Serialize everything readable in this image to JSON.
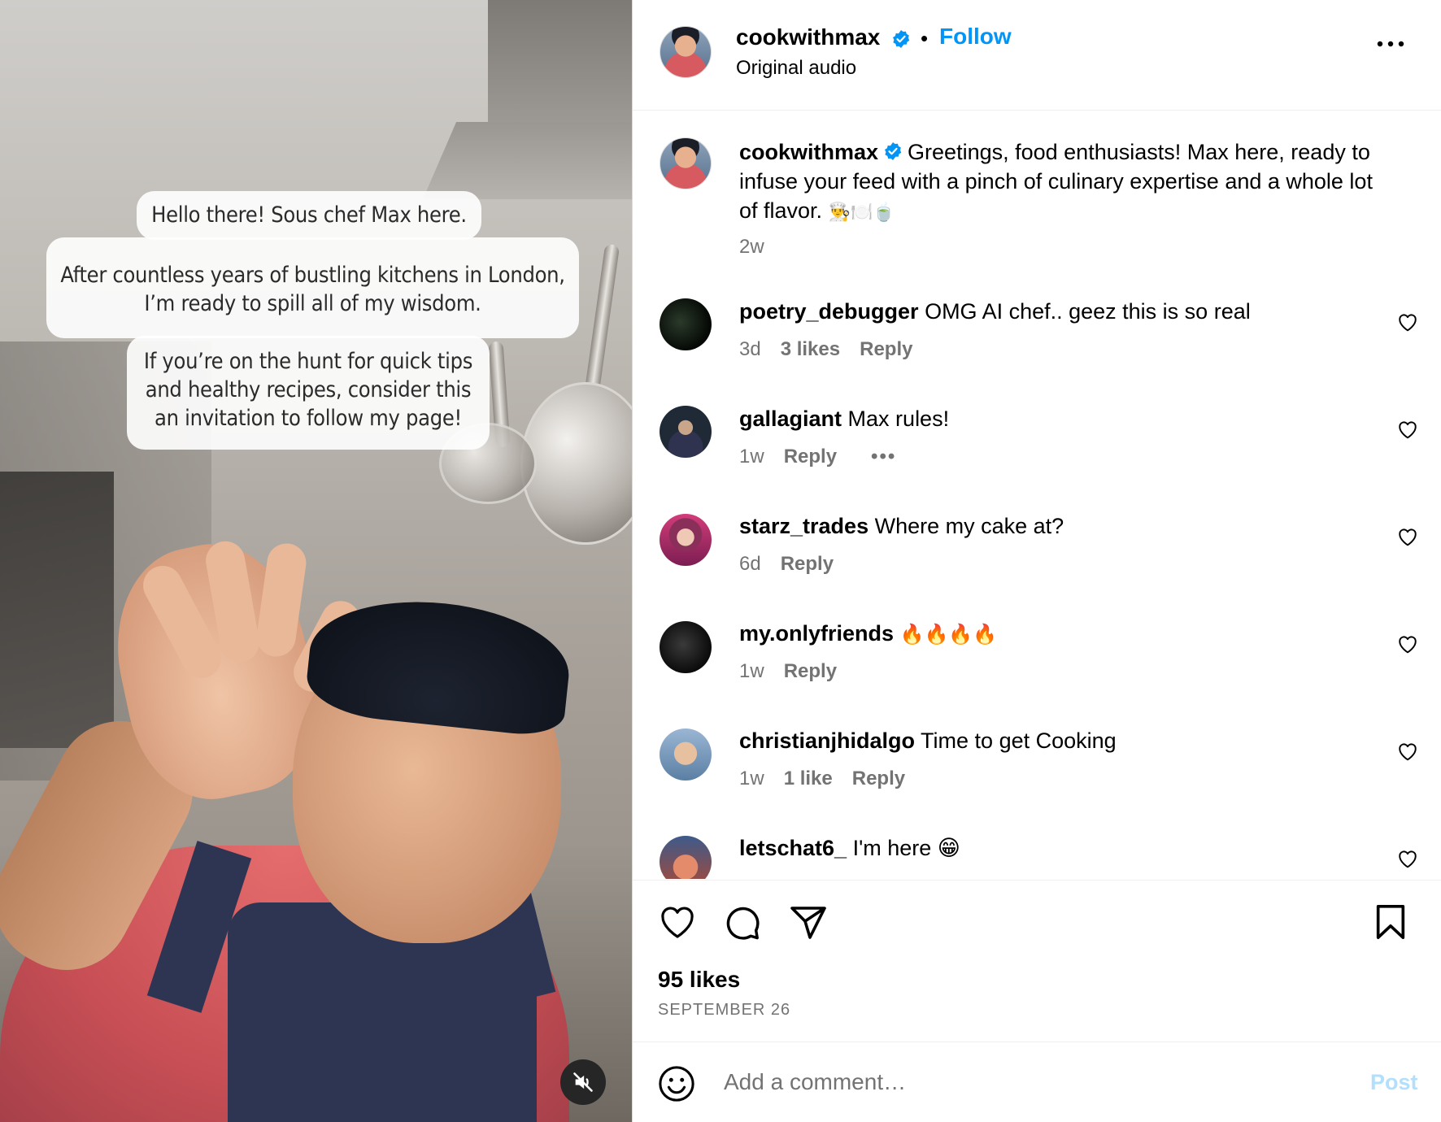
{
  "media": {
    "overlay": {
      "line1": "Hello there! Sous chef Max here.",
      "line2a": "After countless years of bustling kitchens in London,",
      "line2b": "I’m ready to spill all of my wisdom.",
      "line3a": "If you’re on the hunt for quick tips",
      "line3b": "and healthy recipes, consider this",
      "line3c": "an invitation to follow my page!"
    },
    "mute_icon": "speaker-muted-icon"
  },
  "header": {
    "username": "cookwithmax",
    "separator": "•",
    "follow_label": "Follow",
    "audio_label": "Original audio"
  },
  "caption": {
    "username": "cookwithmax",
    "text": "Greetings, food enthusiasts! Max here, ready to infuse your feed with a pinch of culinary expertise and a whole lot of flavor.",
    "emoji": "👨‍🍳🍽️🍵",
    "time": "2w"
  },
  "comments": [
    {
      "username": "poetry_debugger",
      "text": "OMG AI chef.. geez this is so real",
      "time": "3d",
      "likes": "3 likes",
      "reply": "Reply"
    },
    {
      "username": "gallagiant",
      "text": "Max rules!",
      "time": "1w",
      "likes": "",
      "reply": "Reply",
      "more": "•••"
    },
    {
      "username": "starz_trades",
      "text": "Where my cake at?",
      "time": "6d",
      "likes": "",
      "reply": "Reply"
    },
    {
      "username": "my.onlyfriends",
      "text": "🔥🔥🔥🔥",
      "time": "1w",
      "likes": "",
      "reply": "Reply"
    },
    {
      "username": "christianjhidalgo",
      "text": "Time to get Cooking",
      "time": "1w",
      "likes": "1 like",
      "reply": "Reply"
    },
    {
      "username": "letschat6_",
      "text": "I'm here 😁",
      "time": "",
      "likes": "",
      "reply": ""
    }
  ],
  "actions": {
    "likes": "95 likes",
    "date": "SEPTEMBER 26"
  },
  "composer": {
    "placeholder": "Add a comment…",
    "post_label": "Post"
  },
  "colors": {
    "accent": "#0095f6",
    "muted_text": "#737373",
    "post_disabled": "#b2dffc"
  }
}
